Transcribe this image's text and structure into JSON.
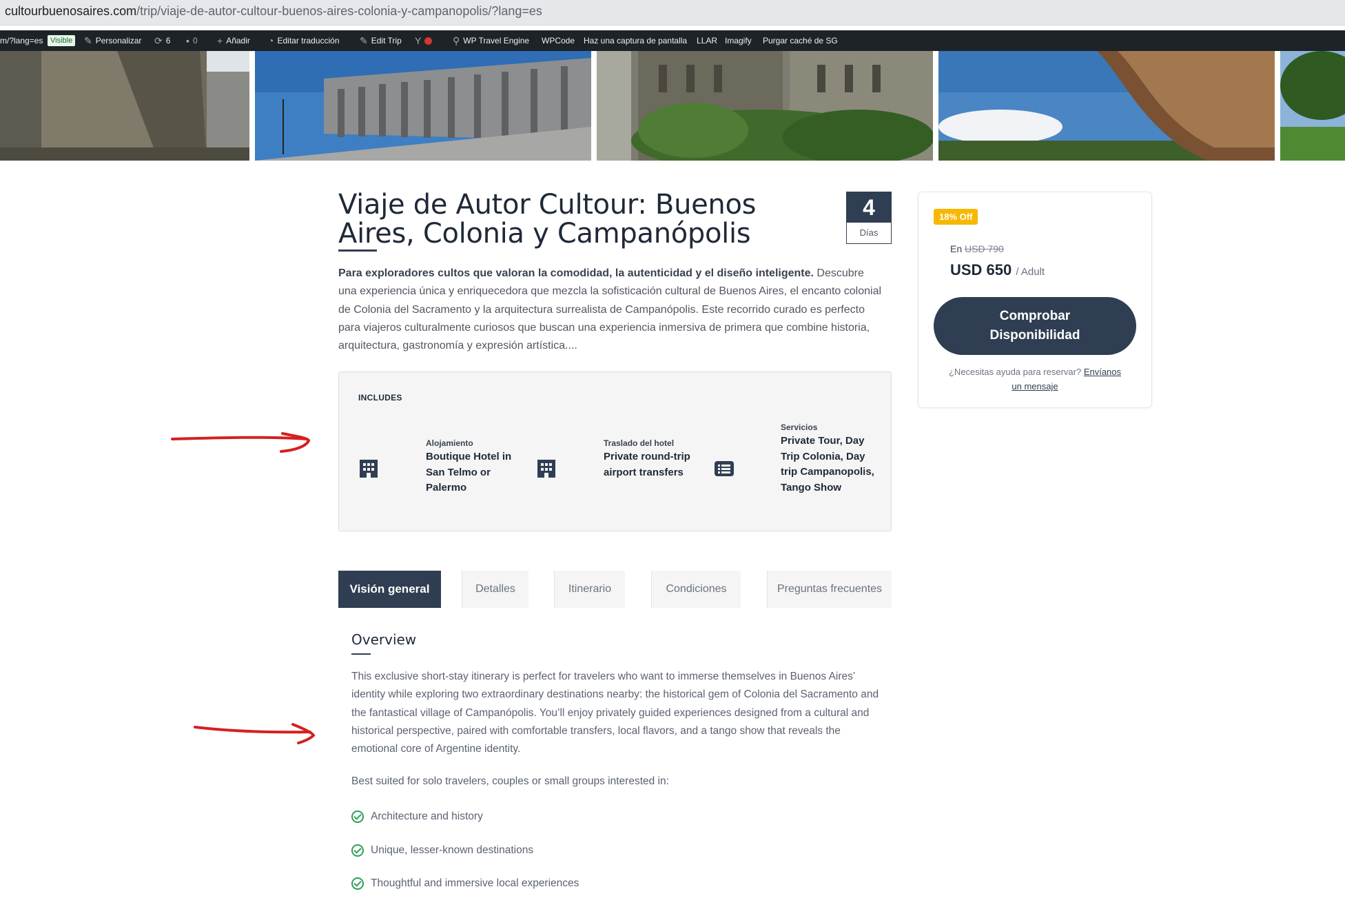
{
  "browser": {
    "url_host": "cultourbuenosaires.com",
    "url_path": "/trip/viaje-de-autor-cultour-buenos-aires-colonia-y-campanopolis/?lang=es"
  },
  "adminbar": {
    "lang_fragment": "m/?lang=es",
    "visible_badge": "Visible",
    "customize": "Personalizar",
    "updates_count": "6",
    "comments_count": "0",
    "add_new": "Añadir",
    "edit_translation": "Editar traducción",
    "edit_trip": "Edit Trip",
    "wp_travel_engine": "WP Travel Engine",
    "wpcode": "WPCode",
    "screenshot": "Haz una captura de pantalla",
    "llar": "LLAR",
    "imagify": "Imagify",
    "purge_cache": "Purgar caché de SG"
  },
  "trip": {
    "title": "Viaje de Autor Cultour: Buenos Aires, Colonia y Campanópolis",
    "days_number": "4",
    "days_label": "Días",
    "desc_bold": "Para exploradores cultos que valoran la comodidad, la autenticidad y el diseño inteligente.",
    "desc_rest": " Descubre una experiencia única y enriquecedora que mezcla la sofisticación cultural de Buenos Aires, el encanto colonial de Colonia del Sacramento y la arquitectura surrealista de Campanópolis. Este recorrido curado es perfecto para viajeros culturalmente curiosos que buscan una experiencia inmersiva de primera que combine historia, arquitectura, gastronomía y expresión artística...."
  },
  "includes": {
    "heading": "INCLUDES",
    "items": [
      {
        "label": "Alojamiento",
        "value": "Boutique Hotel in San Telmo or Palermo",
        "icon": "building-icon"
      },
      {
        "label": "Traslado del hotel",
        "value": "Private round-trip airport transfers",
        "icon": "building-icon"
      },
      {
        "label": "Servicios",
        "value": "Private Tour, Day Trip Colonia, Day trip Campanopolis, Tango Show",
        "icon": "list-icon"
      }
    ]
  },
  "tabs": [
    {
      "label": "Visión general",
      "active": true
    },
    {
      "label": "Detalles",
      "active": false
    },
    {
      "label": "Itinerario",
      "active": false
    },
    {
      "label": "Condiciones",
      "active": false
    },
    {
      "label": "Preguntas frecuentes",
      "active": false
    }
  ],
  "overview": {
    "title": "Overview",
    "text": "This exclusive short-stay itinerary is perfect for travelers who want to immerse themselves in Buenos Aires’ identity while exploring two extraordinary destinations nearby: the historical gem of Colonia del Sacramento and the fantastical village of Campanópolis. You’ll enjoy privately guided experiences designed from a cultural and historical perspective, paired with comfortable transfers, local flavors, and a tango show that reveals the emotional core of Argentine identity.",
    "suited": "Best suited for solo travelers, couples or small groups interested in:",
    "list": [
      "Architecture and history",
      "Unique, lesser-known destinations",
      "Thoughtful and immersive local experiences"
    ]
  },
  "pricing": {
    "discount_badge": "18% Off",
    "from_label": "En",
    "old_price": "USD 790",
    "price": "USD 650",
    "per": "/ Adult",
    "cta_line1": "Comprobar",
    "cta_line2": "Disponibilidad",
    "help_text": "¿Necesitas ayuda para reservar?",
    "help_link_1": "Envíanos",
    "help_link_2": "un mensaje"
  },
  "colors": {
    "primary": "#2f3e52",
    "badge": "#f6b800",
    "check": "#2e9e58",
    "annotation_arrow": "#d42020"
  }
}
